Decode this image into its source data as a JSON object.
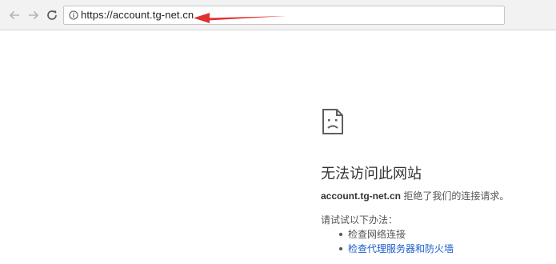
{
  "toolbar": {
    "back_icon": "arrow-left-icon",
    "forward_icon": "arrow-right-icon",
    "reload_icon": "reload-icon",
    "info_icon": "info-icon",
    "url": "https://account.tg-net.cn"
  },
  "annotation": {
    "arrow_color": "#e03030"
  },
  "error": {
    "icon": "sad-page-icon",
    "title": "无法访问此网站",
    "host": "account.tg-net.cn",
    "message": " 拒绝了我们的连接请求。",
    "suggestions_heading": "请试试以下办法：",
    "suggestions": [
      {
        "label": "检查网络连接",
        "is_link": false
      },
      {
        "label": "检查代理服务器和防火墙",
        "is_link": true
      }
    ]
  },
  "colors": {
    "link": "#1a5dc8",
    "toolbar_bg": "#f2f2f2"
  }
}
